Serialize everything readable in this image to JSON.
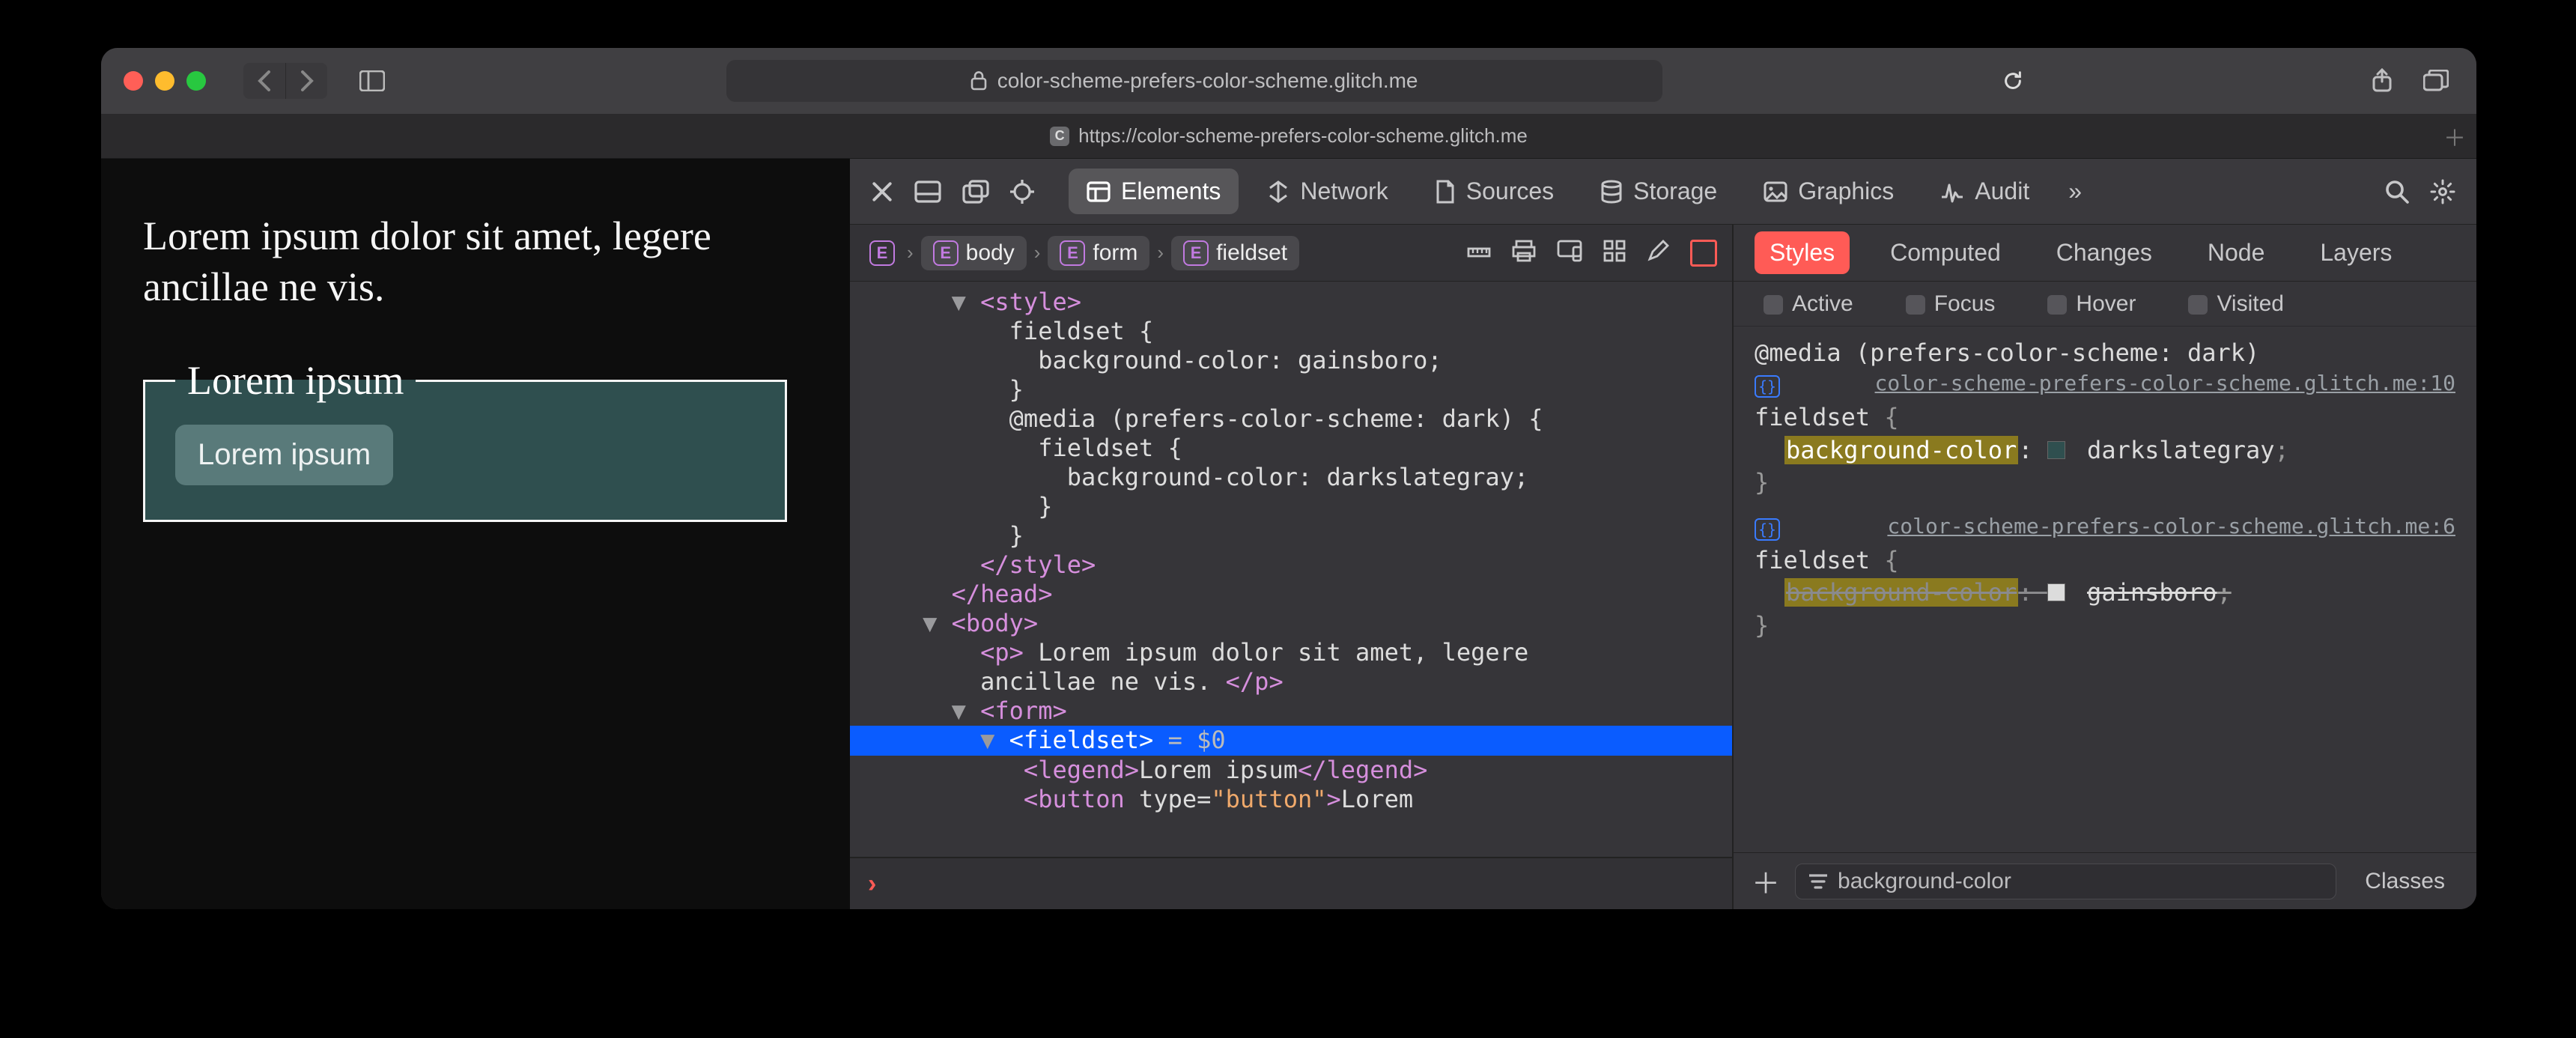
{
  "browser": {
    "address": "color-scheme-prefers-color-scheme.glitch.me",
    "lock_icon": "lock-icon",
    "tab": {
      "favicon_letter": "C",
      "title": "https://color-scheme-prefers-color-scheme.glitch.me"
    }
  },
  "page": {
    "paragraph": "Lorem ipsum dolor sit amet, legere ancillae ne vis.",
    "legend": "Lorem ipsum",
    "button": "Lorem ipsum",
    "fieldset_bg": "#2f4f4f"
  },
  "devtools": {
    "tabs": [
      "Elements",
      "Network",
      "Sources",
      "Storage",
      "Graphics",
      "Audit"
    ],
    "active_tab": "Elements",
    "overflow": "»",
    "breadcrumb": [
      "body",
      "form",
      "fieldset"
    ],
    "tree": {
      "style_open": "<style>",
      "rule1_sel": "fieldset {",
      "rule1_decl": "background-color: gainsboro;",
      "rule1_close": "}",
      "media_open": "@media (prefers-color-scheme: dark) {",
      "rule2_sel": "fieldset {",
      "rule2_decl": "background-color: darkslategray;",
      "rule2_close": "}",
      "media_close": "}",
      "style_close": "</style>",
      "head_close": "</head>",
      "body_open": "<body>",
      "p_line": "<p> Lorem ipsum dolor sit amet, legere ancillae ne vis. </p>",
      "form_open": "<form>",
      "fieldset_open": "<fieldset>",
      "dollar": " = $0",
      "legend_line": "<legend>Lorem ipsum</legend>",
      "button_line": "<button type=\"button\">Lorem"
    },
    "styles_panel": {
      "tabs": [
        "Styles",
        "Computed",
        "Changes",
        "Node",
        "Layers"
      ],
      "active_tab": "Styles",
      "pseudo": [
        "Active",
        "Focus",
        "Hover",
        "Visited"
      ],
      "rule1": {
        "media": "@media (prefers-color-scheme: dark)",
        "source": "color-scheme-prefers-color-scheme.glitch.me:10",
        "selector": "fieldset",
        "property": "background-color",
        "value": "darkslategray",
        "swatch": "#2f4f4f",
        "overridden": false
      },
      "rule2": {
        "source": "color-scheme-prefers-color-scheme.glitch.me:6",
        "selector": "fieldset",
        "property": "background-color",
        "value": "gainsboro",
        "swatch": "#dcdcdc",
        "overridden": true
      },
      "filter": "background-color",
      "classes_label": "Classes"
    }
  }
}
